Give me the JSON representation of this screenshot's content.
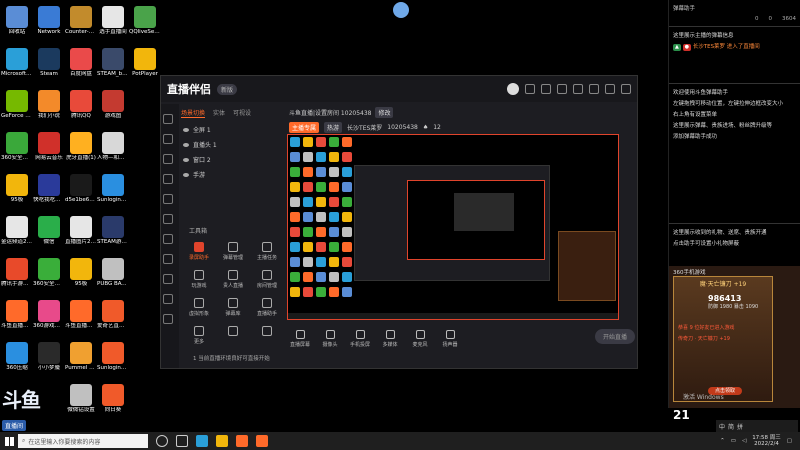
{
  "desktop": {
    "icons": [
      {
        "label": "回收站",
        "color": "#5a8dd6"
      },
      {
        "label": "Network",
        "color": "#3a7bd5"
      },
      {
        "label": "Counter-S Global Off...",
        "color": "#c28b2c"
      },
      {
        "label": "选手直播间",
        "color": "#e6e6e6"
      },
      {
        "label": "QQliveSet...",
        "color": "#4aa34a"
      },
      {
        "label": "Microsoft Edge",
        "color": "#2a9fd8"
      },
      {
        "label": "Steam",
        "color": "#1b3a5e"
      },
      {
        "label": "百度网盘",
        "color": "#ea4a4a"
      },
      {
        "label": "STEAM_bo...",
        "color": "#3a4a6a"
      },
      {
        "label": "PotPlayer",
        "color": "#f2b60c"
      },
      {
        "label": "GeForce Experience",
        "color": "#76b900"
      },
      {
        "label": "我们小说",
        "color": "#f38a2a"
      },
      {
        "label": "腾讯QQ",
        "color": "#e84a3a"
      },
      {
        "label": "游戏图",
        "color": "#c43a30"
      },
      {
        "label": "",
        "color": "#000"
      },
      {
        "label": "360安全浏览器",
        "color": "#3aa83a"
      },
      {
        "label": "网易云音乐",
        "color": "#d0302a"
      },
      {
        "label": "虎牙直播(1)",
        "color": "#ffb020"
      },
      {
        "label": "人物—和滑雪Human Fe...",
        "color": "#d8d8d8"
      },
      {
        "label": "",
        "color": "#000"
      },
      {
        "label": "95极",
        "color": "#f2b60c"
      },
      {
        "label": "快吃我吃游戏",
        "color": "#2a3a9a"
      },
      {
        "label": "d5e1be69...",
        "color": "#1a1a1a"
      },
      {
        "label": "SunloginCl...",
        "color": "#2a8fe0"
      },
      {
        "label": "",
        "color": "#000"
      },
      {
        "label": "金运频道2021100...",
        "color": "#e6e6e6"
      },
      {
        "label": "微信",
        "color": "#2aae4a"
      },
      {
        "label": "直播图片2021001...",
        "color": "#e6e6e6"
      },
      {
        "label": "STEAM游戏管家",
        "color": "#2a3a6a"
      },
      {
        "label": "",
        "color": "#000"
      },
      {
        "label": "腾讯手游助手",
        "color": "#e84a2a"
      },
      {
        "label": "360安全卫士",
        "color": "#3aae3a"
      },
      {
        "label": "95极",
        "color": "#f2b60c"
      },
      {
        "label": "PUBG BATTLEGR...",
        "color": "#c0c0c0"
      },
      {
        "label": "",
        "color": "#000"
      },
      {
        "label": "斗鱼直播伴侣",
        "color": "#ff6a2a"
      },
      {
        "label": "360游戏管家",
        "color": "#e84a8a"
      },
      {
        "label": "斗鱼直播伴侣",
        "color": "#ff6a2a"
      },
      {
        "label": "爱奇艺直播伴侣",
        "color": "#f05a2a"
      },
      {
        "label": "",
        "color": "#000"
      },
      {
        "label": "360压缩",
        "color": "#2a8fe0"
      },
      {
        "label": "小小梦魇",
        "color": "#2a2a2a"
      },
      {
        "label": "Pummel Party",
        "color": "#f0a030"
      },
      {
        "label": "SunloginCl...",
        "color": "#f05a2a"
      },
      {
        "label": "",
        "color": "#000"
      },
      {
        "label": "",
        "color": "#000"
      },
      {
        "label": "",
        "color": "#000"
      },
      {
        "label": "微微钻设置",
        "color": "#c0c0c0"
      },
      {
        "label": "向日葵",
        "color": "#f05a2a"
      }
    ]
  },
  "brand_overlay": {
    "logo": "斗鱼",
    "badge": "直播间",
    "room_number": "10205438"
  },
  "app": {
    "title": "直播伴侣",
    "version": "新版",
    "left_tabs": [
      "场景切换",
      "实体",
      "可视设"
    ],
    "scenes": [
      "全屏 1",
      "直播头 1",
      "窗口 2",
      "手游"
    ],
    "tools_label": "工具箱",
    "tools": [
      {
        "label": "录屏助手",
        "red": true
      },
      {
        "label": "弹幕管理",
        "red": false
      },
      {
        "label": "主播任务",
        "red": false
      },
      {
        "label": "玩游戏",
        "red": false
      },
      {
        "label": "贵人直播",
        "red": false
      },
      {
        "label": "房间管理",
        "red": false
      },
      {
        "label": "虚拟形象",
        "red": false
      },
      {
        "label": "弹幕库",
        "red": false
      },
      {
        "label": "直播助手",
        "red": false
      },
      {
        "label": "更多",
        "red": false
      },
      {
        "label": "",
        "red": false
      },
      {
        "label": "",
        "red": false
      }
    ],
    "room": {
      "title_line": "斗鱼直播|设置房间 10205438",
      "badge": "修改",
      "category_badge": "主播专属",
      "tag": "热游",
      "anchor_name": "长沙TES莱罗",
      "room_id": "10205438",
      "likes": "12"
    },
    "bottom_buttons": [
      "直播屏幕",
      "摄像头",
      "手机投屏",
      "多媒体",
      "麦克风",
      "扬声器"
    ],
    "start_button": "开始直播",
    "bottom_tip": "1 当前直播环境良好可直接开始"
  },
  "chat": {
    "header": "弹幕助手",
    "stats": [
      "0",
      "0",
      "3604"
    ],
    "lines": [
      {
        "text": "这里展示主播的弹幕信息",
        "style": "normal"
      },
      {
        "text": "长沙TES莱罗 进入了直播间",
        "style": "entry"
      },
      {
        "text": "欢迎使用斗鱼弹幕助手",
        "style": "normal"
      },
      {
        "text": "左键拖拽可移动位置，左键拉伸边框改变大小",
        "style": "normal"
      },
      {
        "text": "右上角有设置菜单",
        "style": "normal"
      },
      {
        "text": "这里展示弹幕、贵族进场、粉丝牌升级等",
        "style": "normal"
      },
      {
        "text": "添加弹幕助手成功",
        "style": "normal"
      },
      {
        "text": "这里展示收到的礼物、送席、贵族开通",
        "style": "normal"
      },
      {
        "text": "点击助手可设置小礼物屏蔽",
        "style": "normal"
      }
    ],
    "game_panel": {
      "header": "360手机游戏",
      "card_title": "魔·天亡镰刀 +19",
      "big_number": "986413",
      "sub_text": "防御 1980 暴击 1090",
      "promo": "恭喜 9 位好友已进入游戏",
      "red_text": "传奇刀 · 天亡镰刀 +19",
      "button": "点击领取",
      "level": "21"
    },
    "activate_text": "激活 Windows",
    "ime": [
      "中",
      "简",
      "拼"
    ]
  },
  "taskbar": {
    "search_placeholder": "在这里输入你要搜索的内容",
    "time": "17:58 周三",
    "date": "2022/2/4"
  }
}
